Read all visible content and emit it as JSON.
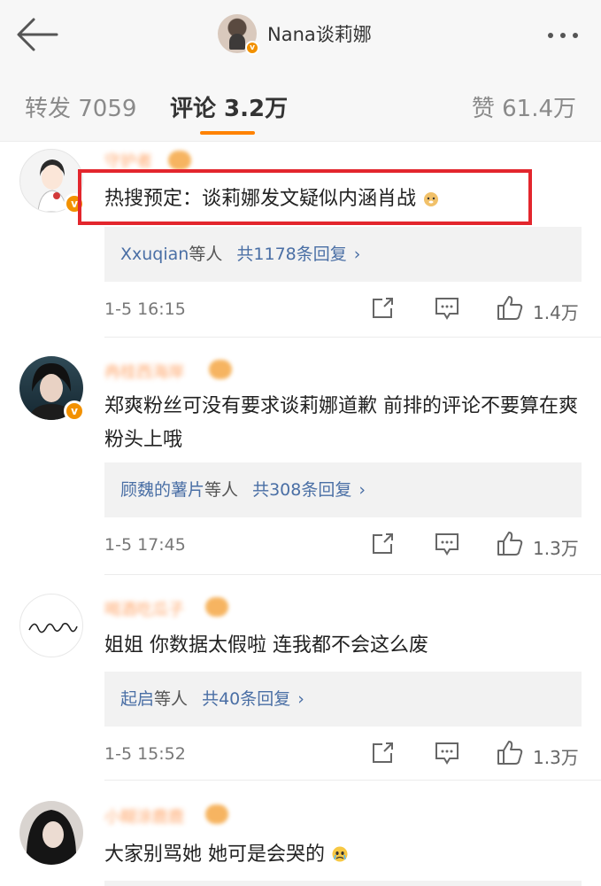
{
  "header": {
    "account_name": "Nana谈莉娜",
    "icons": {
      "back": "back-arrow-icon",
      "more": "more-dots-icon"
    }
  },
  "tabs": {
    "repost": "转发 7059",
    "comments": "评论 3.2万",
    "likes": "赞 61.4万"
  },
  "colors": {
    "accent": "#ff8200",
    "link": "#4a6fa5",
    "highlight": "#e3262d",
    "verified": "#f29100"
  },
  "comments": [
    {
      "username": "守护者",
      "text": "热搜预定：谈莉娜发文疑似内涵肖战",
      "reply_users": "Xxuqian",
      "reply_suffix": "等人",
      "reply_count": "共1178条回复",
      "time": "1-5 16:15",
      "likes": "1.4万"
    },
    {
      "username": "冉桂西海岸",
      "text": "郑爽粉丝可没有要求谈莉娜道歉 前排的评论不要算在爽粉头上哦",
      "reply_users": "顾魏的薯片",
      "reply_suffix": "等人",
      "reply_count": "共308条回复",
      "time": "1-5 17:45",
      "likes": "1.3万"
    },
    {
      "username": "喝酒吃瓜子",
      "text": "姐姐 你数据太假啦 连我都不会这么废",
      "reply_users": "起启",
      "reply_suffix": "等人",
      "reply_count": "共40条回复",
      "time": "1-5 15:52",
      "likes": "1.3万"
    },
    {
      "username": "小糊涂鹿鹿",
      "text": "大家别骂她 她可是会哭的"
    }
  ]
}
